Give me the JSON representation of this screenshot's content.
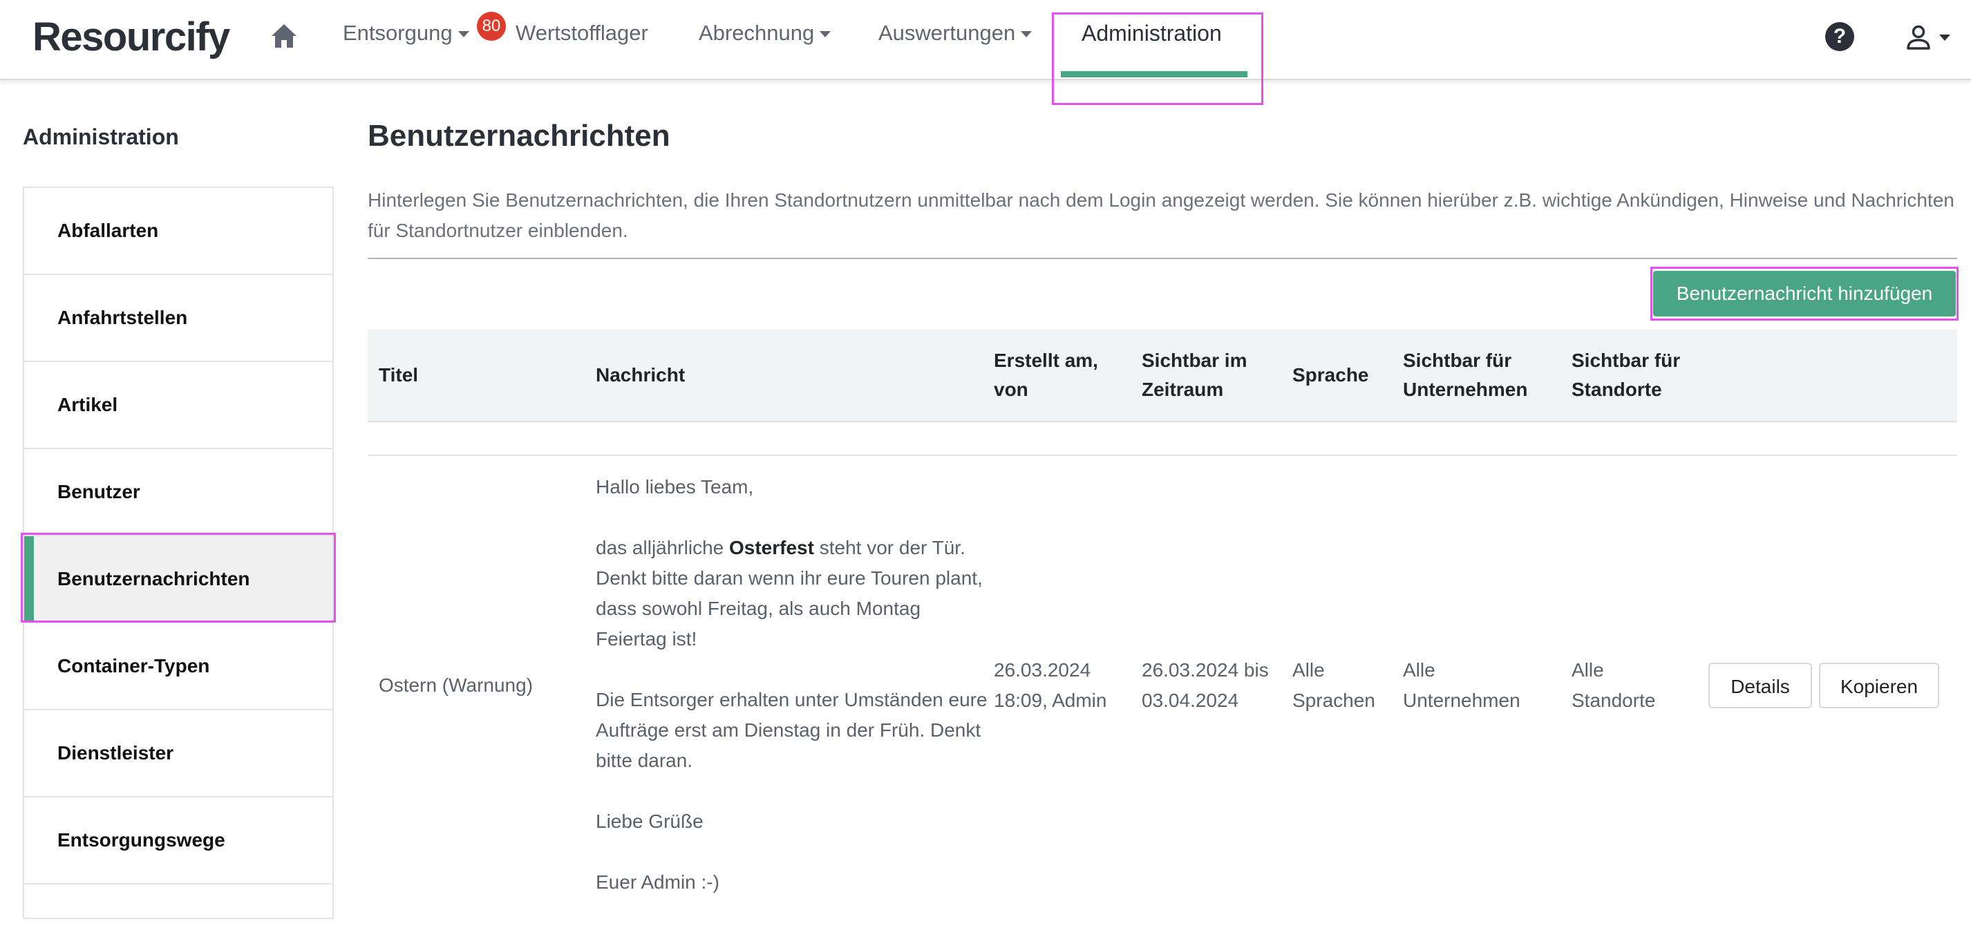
{
  "brand": {
    "logo": "Resourcify"
  },
  "nav": {
    "entsorgung": "Entsorgung",
    "badge_count": "80",
    "wertstofflager": "Wertstofflager",
    "abrechnung": "Abrechnung",
    "auswertungen": "Auswertungen",
    "administration": "Administration",
    "help_icon": "?"
  },
  "sidebar": {
    "title": "Administration",
    "items": [
      {
        "label": "Abfallarten"
      },
      {
        "label": "Anfahrtstellen"
      },
      {
        "label": "Artikel"
      },
      {
        "label": "Benutzer"
      },
      {
        "label": "Benutzernachrichten"
      },
      {
        "label": "Container-Typen"
      },
      {
        "label": "Dienstleister"
      },
      {
        "label": "Entsorgungswege"
      }
    ]
  },
  "main": {
    "title": "Benutzernachrichten",
    "intro": "Hinterlegen Sie Benutzernachrichten, die Ihren Standortnutzern unmittelbar nach dem Login angezeigt werden. Sie können hierüber z.B. wichtige Ankündigen, Hinweise und Nachrichten für Standortnutzer einblenden.",
    "add_button": "Benutzernachricht hinzufügen"
  },
  "table": {
    "headers": {
      "titel": "Titel",
      "nachricht": "Nachricht",
      "erstellt_1": "Erstellt am,",
      "erstellt_2": "von",
      "zeitraum_1": "Sichtbar im",
      "zeitraum_2": "Zeitraum",
      "sprache": "Sprache",
      "unternehmen_1": "Sichtbar für",
      "unternehmen_2": "Unternehmen",
      "standorte_1": "Sichtbar für",
      "standorte_2": "Standorte"
    },
    "row": {
      "titel": "Ostern (Warnung)",
      "msg_greeting": "Hallo liebes Team,",
      "msg_p2_pre": "das alljährliche ",
      "msg_p2_bold": "Osterfest",
      "msg_p2_post": " steht vor der Tür. Denkt bitte daran wenn ihr eure Touren plant, dass sowohl Freitag, als auch Montag Feiertag ist!",
      "msg_p3": "Die Entsorger erhalten unter Umständen eure Aufträge erst am Dienstag in der Früh. Denkt bitte daran.",
      "msg_p4": "Liebe Grüße",
      "msg_p5": "Euer Admin :-)",
      "erstellt_1": "26.03.2024",
      "erstellt_2": "18:09, Admin",
      "zeitraum_1": "26.03.2024 bis",
      "zeitraum_2": "03.04.2024",
      "sprache_1": "Alle",
      "sprache_2": "Sprachen",
      "unternehmen_1": "Alle",
      "unternehmen_2": "Unternehmen",
      "standorte_1": "Alle",
      "standorte_2": "Standorte",
      "details_button": "Details",
      "kopieren_button": "Kopieren"
    }
  }
}
